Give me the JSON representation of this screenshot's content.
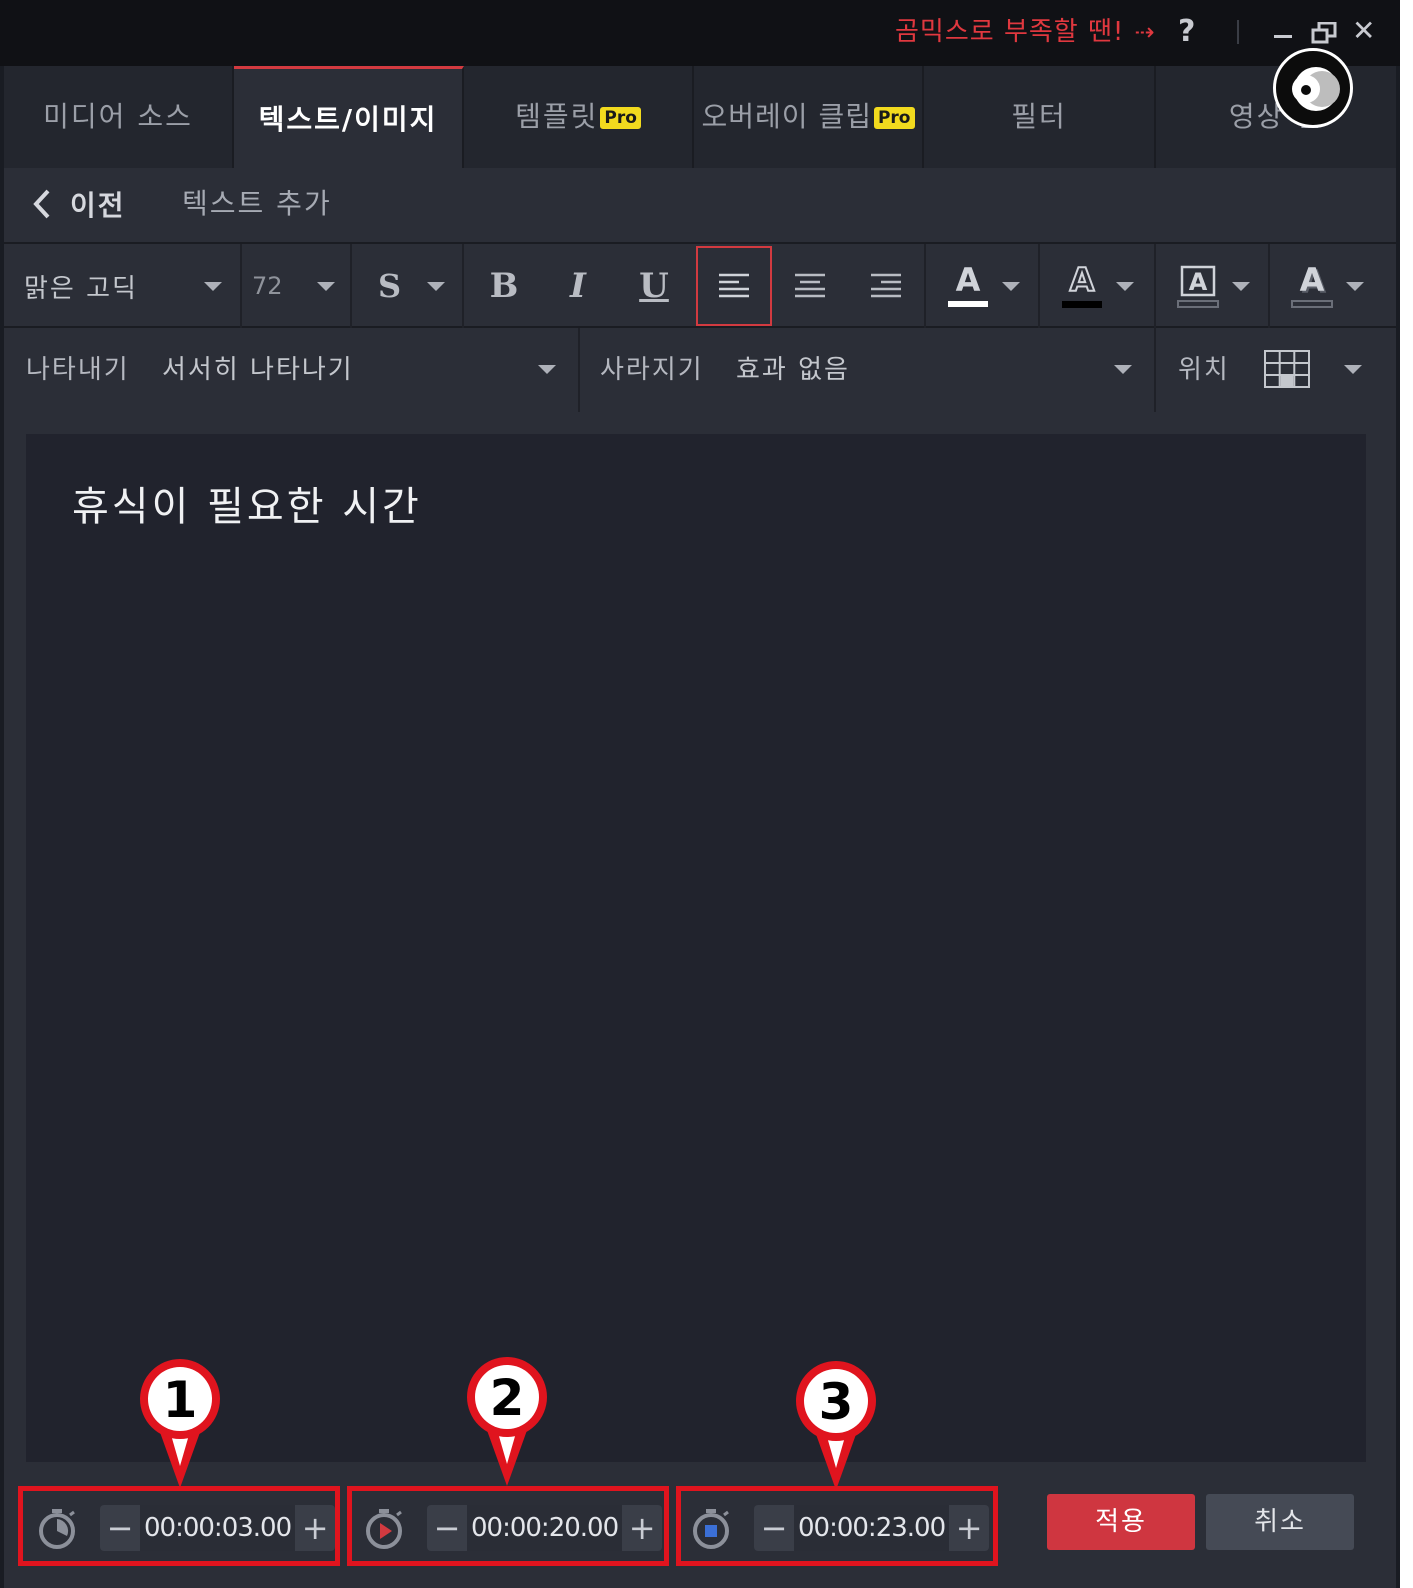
{
  "titlebar": {
    "promo_text": "곰믹스로 부족할 땐!",
    "promo_arrow": "⇢",
    "help": "?",
    "close": "✕"
  },
  "tabs": [
    {
      "label": "미디어 소스",
      "pro": false
    },
    {
      "label": "텍스트/이미지",
      "pro": false,
      "active": true
    },
    {
      "label": "템플릿",
      "pro": true
    },
    {
      "label": "오버레이 클립",
      "pro": true
    },
    {
      "label": "필터",
      "pro": false
    },
    {
      "label": "영상 전",
      "pro": false
    }
  ],
  "pro_badge": "Pro",
  "subheader": {
    "back_label": "이전",
    "title": "텍스트 추가"
  },
  "toolbar": {
    "font_name": "맑은 고딕",
    "font_size": "72",
    "shadow": "S",
    "bold": "B",
    "italic": "I",
    "underline": "U",
    "align_selected": "left",
    "color_letter": "A"
  },
  "effects": {
    "appear_label": "나타내기",
    "appear_value": "서서히 나타나기",
    "disappear_label": "사라지기",
    "disappear_value": "효과 없음",
    "position_label": "위치"
  },
  "editor": {
    "text": "휴식이 필요한 시간"
  },
  "timing": [
    {
      "value": "00:00:03.00",
      "marker": "1"
    },
    {
      "value": "00:00:20.00",
      "marker": "2"
    },
    {
      "value": "00:00:23.00",
      "marker": "3"
    }
  ],
  "buttons": {
    "apply": "적용",
    "cancel": "취소"
  },
  "colors": {
    "accent_red": "#cf3640",
    "pro_yellow": "#f2da1e",
    "annotation_red": "#e0141e"
  }
}
